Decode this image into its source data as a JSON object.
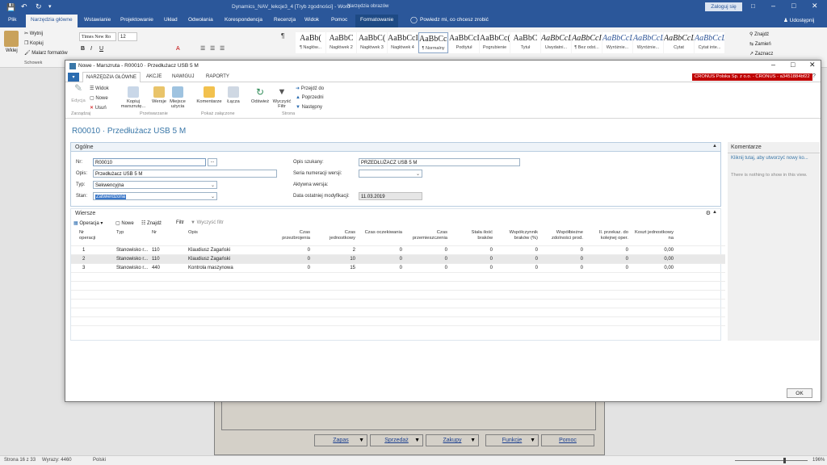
{
  "word": {
    "title": "Dynamics_NAV_lekcje3_4 [Tryb zgodności] - Word",
    "context_tab": "Narzędzia obrazów",
    "signin": "Zaloguj się",
    "tabs": [
      "Plik",
      "Narzędzia główne",
      "Wstawianie",
      "Projektowanie",
      "Układ",
      "Odwołania",
      "Korespondencja",
      "Recenzja",
      "Widok",
      "Pomoc",
      "Formatowanie"
    ],
    "tell_me": "Powiedz mi, co chcesz zrobić",
    "share": "Udostępnij",
    "clipboard": {
      "paste": "Wklej",
      "cut": "Wytnij",
      "copy": "Kopiuj",
      "painter": "Malarz formatów",
      "group": "Schowek"
    },
    "font_name": "Times New Ro",
    "font_size": "12",
    "styles": [
      {
        "sample": "AaBb(",
        "name": "¶ Nagłów..."
      },
      {
        "sample": "AaBbC",
        "name": "Nagłówek 2"
      },
      {
        "sample": "AaBbC(",
        "name": "Nagłówek 3"
      },
      {
        "sample": "AaBbCcI",
        "name": "Nagłówek 4"
      },
      {
        "sample": "AaBbCcI",
        "name": "¶ Normalny"
      },
      {
        "sample": "AaBbCcD",
        "name": "Podtytuł"
      },
      {
        "sample": "AaBbCc(",
        "name": "Pogrubienie"
      },
      {
        "sample": "AaBbC",
        "name": "Tytuł"
      },
      {
        "sample": "AaBbCcL",
        "name": "Uwydatni..."
      },
      {
        "sample": "AaBbCcI",
        "name": "¶ Bez odst..."
      },
      {
        "sample": "AaBbCcL",
        "name": "Wyróżnie..."
      },
      {
        "sample": "AaBbCcL",
        "name": "Wyróżnie..."
      },
      {
        "sample": "AaBbCcL",
        "name": "Cytat"
      },
      {
        "sample": "AaBbCcL",
        "name": "Cytat inte..."
      }
    ],
    "editing": {
      "find": "Znajdź",
      "replace": "Zamień",
      "select": "Zaznacz"
    },
    "status": {
      "page": "Strona 16 z 33",
      "words": "Wyrazy: 4460",
      "lang": "Polski",
      "zoom": "196%"
    },
    "doc_buttons": [
      "Zapas",
      "Sprzedaż",
      "Zakupy",
      "Funkcje",
      "Pomoc"
    ]
  },
  "nav": {
    "window_title": "Nowe - Marszruta - R00010 · Przedłużacz USB 5 M",
    "tabs": [
      "NARZĘDZIA GŁÓWNE",
      "AKCJE",
      "NAWIGUJ",
      "RAPORTY"
    ],
    "company": "CRONUS Polska Sp. z o.o. - CRONUS - a3451884bf22",
    "ribbon": {
      "edit": "Edycja",
      "view": "Widok",
      "new": "Nowe",
      "delete": "Usuń",
      "copy_routing": "Kopiuj marszrutę...",
      "versions": "Wersje",
      "work_centers": "Miejsce użycia",
      "comments": "Komentarze",
      "links": "Łącza",
      "refresh": "Odśwież",
      "clear_filter": "Wyczyść Filtr",
      "goto": "Przejdź do",
      "previous": "Poprzedni",
      "next": "Następny",
      "groups": {
        "manage": "Zarządzaj",
        "process": "Przetwarzanie",
        "attached": "Pokaż załączone",
        "page": "Strona"
      }
    },
    "heading": "R00010 · Przedłużacz USB 5 M",
    "general": {
      "title": "Ogólne",
      "no_label": "Nr:",
      "no_value": "R00010",
      "desc_label": "Opis:",
      "desc_value": "Przedłużacz USB 5 M",
      "type_label": "Typ:",
      "type_value": "Sekwencyjna",
      "status_label": "Stan:",
      "status_value": "Zatwierdzona",
      "search_label": "Opis szukany:",
      "search_value": "PRZEDŁUŻACZ USB 5 M",
      "series_label": "Seria numeracji wersji:",
      "series_value": "",
      "active_label": "Aktywna wersja:",
      "active_value": "",
      "modified_label": "Data ostatniej modyfikacji:",
      "modified_value": "11.03.2019"
    },
    "lines": {
      "title": "Wiersze",
      "toolbar": {
        "operation": "Operacja",
        "new": "Nowe",
        "find": "Znajdź",
        "filter": "Filtr",
        "clear": "Wyczyść filtr"
      },
      "columns": [
        "Nr operacji",
        "Typ",
        "Nr",
        "Opis",
        "Czas przezbrojenia",
        "Czas jednostkowy",
        "Czas oczekiwania",
        "Czas przemieszczenia",
        "Stała ilość braków",
        "Współczynnik braków (%)",
        "Współbieżne zdolności prod.",
        "Il. przekaz. do kolejnej oper.",
        "Koszt jednostkowy na"
      ],
      "rows": [
        [
          "1",
          "Stanowisko r...",
          "110",
          "Klaudiusz Zagański",
          "0",
          "2",
          "0",
          "0",
          "0",
          "0",
          "0",
          "0",
          "0,00"
        ],
        [
          "2",
          "Stanowisko r...",
          "110",
          "Klaudiusz Zagański",
          "0",
          "10",
          "0",
          "0",
          "0",
          "0",
          "0",
          "0",
          "0,00"
        ],
        [
          "3",
          "Stanowisko r...",
          "440",
          "Kontrola maszynowa",
          "0",
          "15",
          "0",
          "0",
          "0",
          "0",
          "0",
          "0",
          "0,00"
        ]
      ]
    },
    "factbox": {
      "title": "Komentarze",
      "link": "Kliknij tutaj, aby utworzyć nowy ko...",
      "empty": "There is nothing to show in this view."
    },
    "ok": "OK"
  }
}
